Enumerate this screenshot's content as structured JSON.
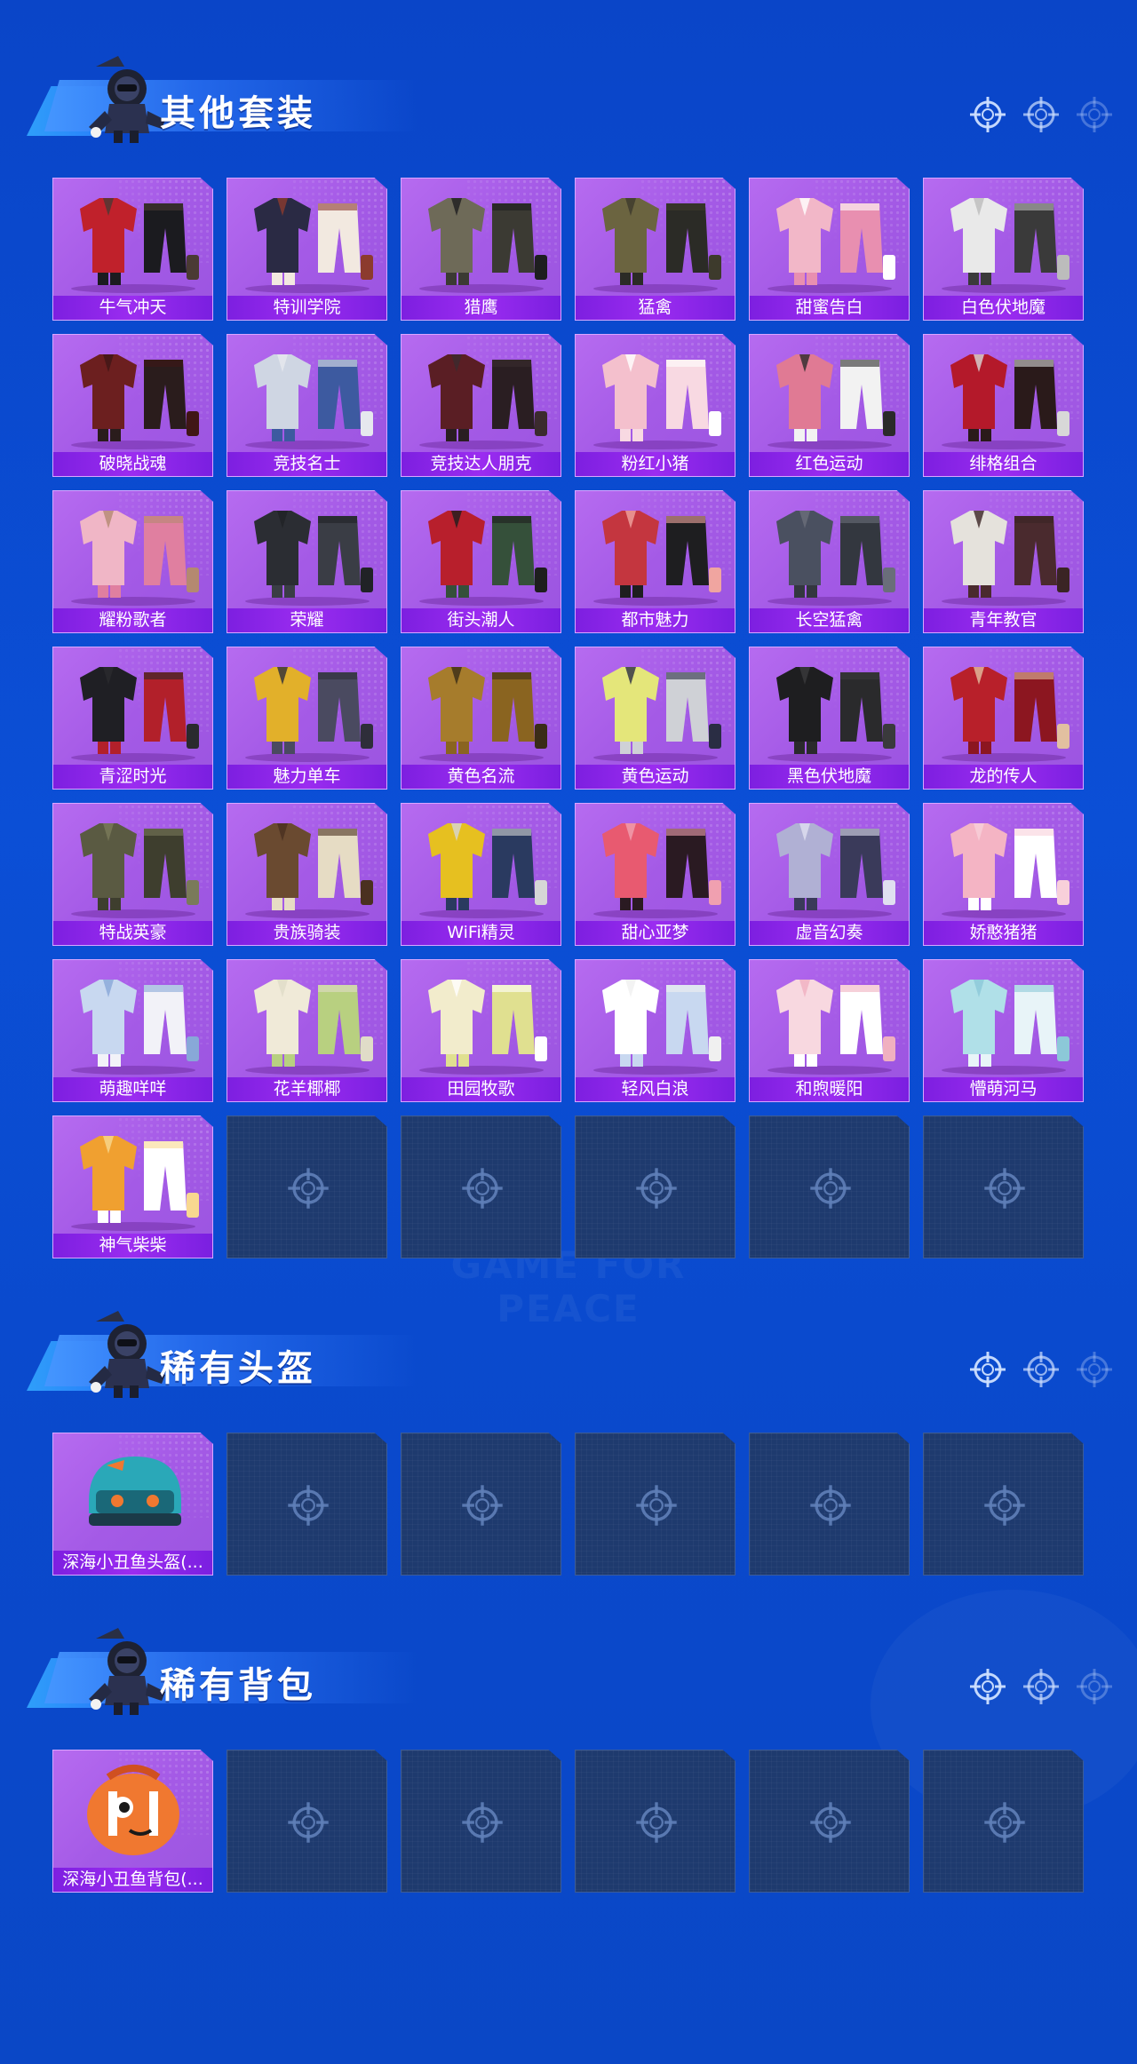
{
  "sections": [
    {
      "title": "其他套装",
      "items": [
        {
          "label": "牛气冲天",
          "palette": [
            "#c0212b",
            "#1b1b1f",
            "#4a3a34"
          ]
        },
        {
          "label": "特训学院",
          "palette": [
            "#2a2a44",
            "#f2e9e0",
            "#8c3b2e"
          ]
        },
        {
          "label": "猎鹰",
          "palette": [
            "#6e6a58",
            "#3b3a33",
            "#1e1e20"
          ]
        },
        {
          "label": "猛禽",
          "palette": [
            "#6b6440",
            "#2b2b26",
            "#3d3a2c"
          ]
        },
        {
          "label": "甜蜜告白",
          "palette": [
            "#f2b7c8",
            "#e88fb0",
            "#ffffff"
          ]
        },
        {
          "label": "白色伏地魔",
          "palette": [
            "#e9e9e9",
            "#3a3a3a",
            "#bcbcbc"
          ]
        },
        {
          "label": "破晓战魂",
          "palette": [
            "#6c1f1f",
            "#2a1c1c",
            "#401616"
          ]
        },
        {
          "label": "竞技名士",
          "palette": [
            "#cfd6e3",
            "#3d5aa0",
            "#e6e8ee"
          ]
        },
        {
          "label": "竞技达人朋克",
          "palette": [
            "#5a1e24",
            "#2a1e22",
            "#3b2b2e"
          ]
        },
        {
          "label": "粉红小猪",
          "palette": [
            "#f4c0cd",
            "#f8d9e2",
            "#ffffff"
          ]
        },
        {
          "label": "红色运动",
          "palette": [
            "#e07a94",
            "#f2f2f2",
            "#2a2a2a"
          ]
        },
        {
          "label": "绯格组合",
          "palette": [
            "#b4192a",
            "#2a1a1a",
            "#d8d8d8"
          ]
        },
        {
          "label": "耀粉歌者",
          "palette": [
            "#f0b6c6",
            "#e07fa0",
            "#b48970"
          ]
        },
        {
          "label": "荣耀",
          "palette": [
            "#2b2d33",
            "#3a3d45",
            "#202226"
          ]
        },
        {
          "label": "街头潮人",
          "palette": [
            "#b81f2c",
            "#35503a",
            "#1e1e1e"
          ]
        },
        {
          "label": "都市魅力",
          "palette": [
            "#c4363f",
            "#1e1e20",
            "#f0a5a0"
          ]
        },
        {
          "label": "长空猛禽",
          "palette": [
            "#4a5060",
            "#33373f",
            "#6a6e7a"
          ]
        },
        {
          "label": "青年教官",
          "palette": [
            "#e5e2dc",
            "#4a2a2e",
            "#3a2424"
          ]
        },
        {
          "label": "青涩时光",
          "palette": [
            "#1f1f24",
            "#b2202a",
            "#2a2a2e"
          ]
        },
        {
          "label": "魅力单车",
          "palette": [
            "#e2b02a",
            "#4a4a60",
            "#2e2e3a"
          ]
        },
        {
          "label": "黄色名流",
          "palette": [
            "#a67c2c",
            "#8a6420",
            "#3a2c18"
          ]
        },
        {
          "label": "黄色运动",
          "palette": [
            "#e4e67a",
            "#cfd1d6",
            "#2a2d44"
          ]
        },
        {
          "label": "黑色伏地魔",
          "palette": [
            "#1e1e20",
            "#2a2a2c",
            "#3a3a3c"
          ]
        },
        {
          "label": "龙的传人",
          "palette": [
            "#b8202a",
            "#8c1620",
            "#e2c0a0"
          ]
        },
        {
          "label": "特战英豪",
          "palette": [
            "#5a5a42",
            "#3e3e2e",
            "#7a7a5a"
          ]
        },
        {
          "label": "贵族骑装",
          "palette": [
            "#6a4a30",
            "#e6dcc4",
            "#4a3020"
          ]
        },
        {
          "label": "WiFi精灵",
          "palette": [
            "#e6c020",
            "#2a3a60",
            "#d6d6d6"
          ]
        },
        {
          "label": "甜心亚梦",
          "palette": [
            "#e85a70",
            "#2a1a22",
            "#f0a0b0"
          ]
        },
        {
          "label": "虚音幻奏",
          "palette": [
            "#b0b0d4",
            "#3a3a5a",
            "#e0e0f0"
          ]
        },
        {
          "label": "娇憨猪猪",
          "palette": [
            "#f4b4c4",
            "#ffffff",
            "#f8d0da"
          ]
        },
        {
          "label": "萌趣咩咩",
          "palette": [
            "#c8d8f0",
            "#f2f2f8",
            "#88a8d8"
          ]
        },
        {
          "label": "花羊椰椰",
          "palette": [
            "#f0ead8",
            "#b8d080",
            "#e0dcc8"
          ]
        },
        {
          "label": "田园牧歌",
          "palette": [
            "#f2eccc",
            "#e0e090",
            "#ffffff"
          ]
        },
        {
          "label": "轻风白浪",
          "palette": [
            "#ffffff",
            "#c8d8f0",
            "#f0f0f0"
          ]
        },
        {
          "label": "和煦暖阳",
          "palette": [
            "#f8d8e0",
            "#ffffff",
            "#f0b0c0"
          ]
        },
        {
          "label": "懵萌河马",
          "palette": [
            "#b0e0e8",
            "#e8f4f8",
            "#8cc8d8"
          ]
        },
        {
          "label": "神气柴柴",
          "palette": [
            "#f0a030",
            "#ffffff",
            "#f8d890"
          ]
        }
      ],
      "empty_slots": 5
    },
    {
      "title": "稀有头盔",
      "items": [
        {
          "label": "深海小丑鱼头盔(...",
          "palette": [
            "#2aa8b8",
            "#1a6878",
            "#f07830"
          ]
        }
      ],
      "empty_slots": 5
    },
    {
      "title": "稀有背包",
      "items": [
        {
          "label": "深海小丑鱼背包(...",
          "palette": [
            "#f07830",
            "#ffffff",
            "#d05020"
          ]
        }
      ],
      "empty_slots": 5
    }
  ],
  "watermark": "GAME FOR PEACE",
  "colors": {
    "background": "#0b4bd0",
    "card": "#a65cea",
    "label_bar": "#8a24e8",
    "empty_card": "#1e3a6e"
  },
  "icons": {
    "header_indicator": "crosshair-icon",
    "empty_slot": "crosshair-icon",
    "header_avatar": "parachuting-soldier-icon"
  }
}
